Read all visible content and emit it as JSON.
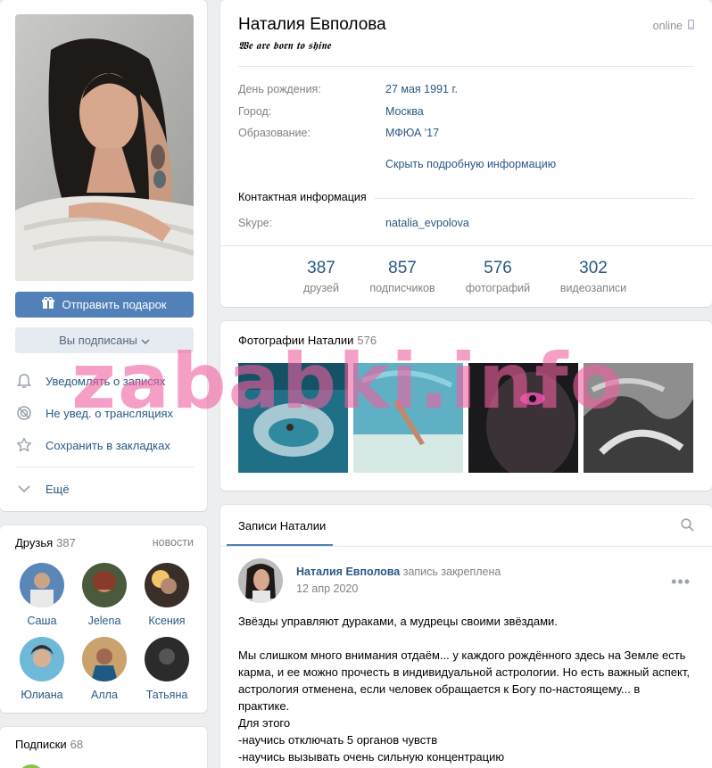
{
  "profile": {
    "name": "Наталия Евполова",
    "status": "𝖂𝖊 𝖆𝖗𝖊 𝖇𝖔𝖗𝖓 𝖙𝖔 𝖘𝖍𝖎𝖓𝖊",
    "online": "online",
    "gift_button": "Отправить подарок",
    "subscribed_button": "Вы подписаны"
  },
  "actions": [
    {
      "icon": "bell-icon",
      "label": "Уведомлять о записях"
    },
    {
      "icon": "broadcast-off-icon",
      "label": "Не увед. о трансляциях"
    },
    {
      "icon": "star-icon",
      "label": "Сохранить в закладках"
    }
  ],
  "more_label": "Ещё",
  "info": {
    "rows": [
      {
        "label": "День рождения:",
        "value": "27 мая 1991 г."
      },
      {
        "label": "Город:",
        "value": "Москва"
      },
      {
        "label": "Образование:",
        "value": "МФЮА '17"
      }
    ],
    "toggle_link": "Скрыть подробную информацию",
    "contact_section": "Контактная информация",
    "contact_rows": [
      {
        "label": "Skype:",
        "value": "natalia_evpolova"
      }
    ]
  },
  "counters": [
    {
      "num": "387",
      "label": "друзей"
    },
    {
      "num": "857",
      "label": "подписчиков"
    },
    {
      "num": "576",
      "label": "фотографий"
    },
    {
      "num": "302",
      "label": "видеозаписи"
    }
  ],
  "photos": {
    "title": "Фотографии Наталии",
    "count": "576"
  },
  "friends": {
    "title": "Друзья",
    "count": "387",
    "link": "новости",
    "items": [
      "Саша",
      "Jelena",
      "Ксения",
      "Юлиана",
      "Алла",
      "Татьяна"
    ]
  },
  "subscriptions": {
    "title": "Подписки",
    "count": "68"
  },
  "wall": {
    "tab": "Записи Наталии",
    "post": {
      "author": "Наталия Евполова",
      "pinned": "запись закреплена",
      "date": "12 апр 2020",
      "lines": [
        "Звёзды управляют дураками, а мудрецы своими звёздами.",
        "",
        "Мы слишком много внимания отдаём... у каждого рождённого здесь на Земле есть карма, и ее можно прочесть в индивидуальной астрологии. Но есть важный аспект, астрология отменена, если человек обращается к Богу по-настоящему... в практике.",
        "Для этого",
        "-научись отключать 5 органов чувств",
        "-научись вызывать очень сильную концентрацию"
      ]
    }
  },
  "watermark": "zababki.info",
  "colors": {
    "accent": "#5181b8",
    "link": "#2a5885",
    "muted": "#828282",
    "bg": "#edeef0"
  }
}
